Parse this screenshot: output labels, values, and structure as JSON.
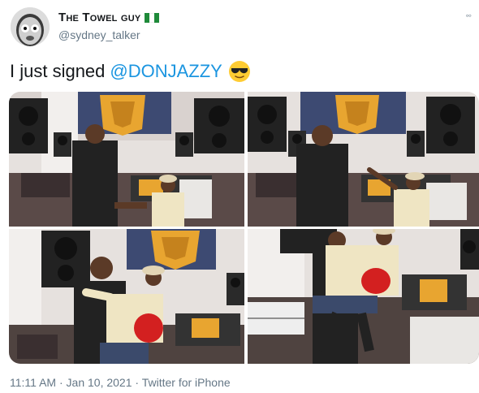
{
  "author": {
    "display_name": "The Towel guy",
    "handle": "@sydney_talker",
    "flag_colors": [
      "#1f8a3a",
      "#ffffff",
      "#1f8a3a"
    ]
  },
  "tweet": {
    "text": "I just signed",
    "mention": "@DONJAZZY",
    "emoji": "sunglasses-face"
  },
  "media": {
    "photos": [
      {
        "alt": "studio handshake"
      },
      {
        "alt": "studio pointing"
      },
      {
        "alt": "studio hug"
      },
      {
        "alt": "studio lift"
      }
    ]
  },
  "meta": {
    "time": "11:11 AM",
    "separator": " · ",
    "date": "Jan 10, 2021",
    "separator2": " · ",
    "source": "Twitter for iPhone"
  },
  "colors": {
    "link": "#1b95e0",
    "muted": "#657786",
    "logo_gold": "#e8a530"
  }
}
